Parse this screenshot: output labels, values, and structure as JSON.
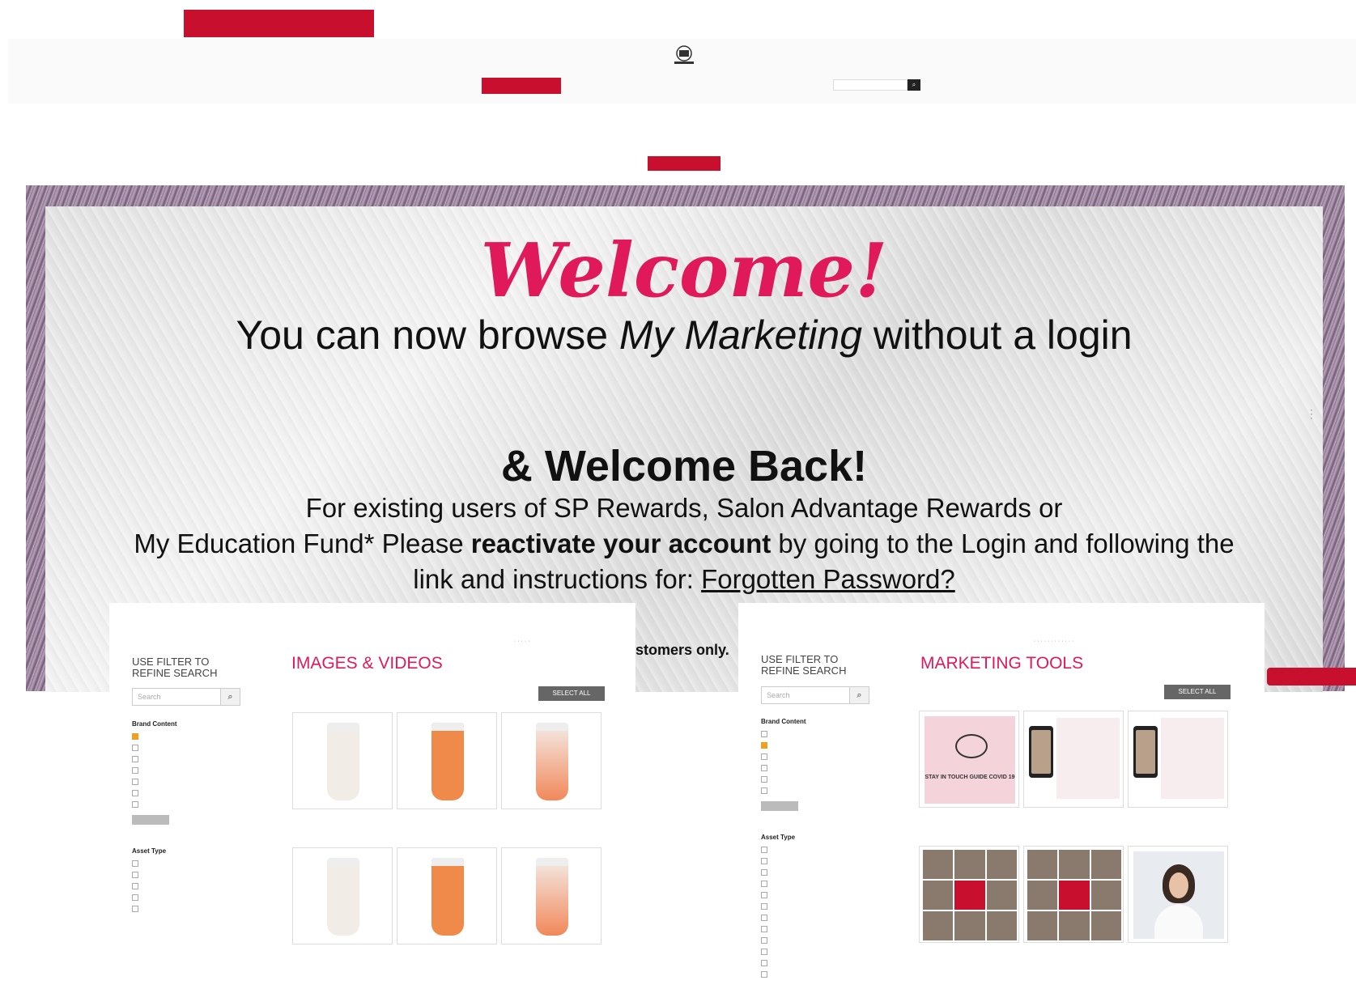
{
  "topbar": {
    "links": [
      "",
      "",
      "",
      ""
    ],
    "red_tabs": [
      "",
      "",
      ""
    ],
    "lang": ""
  },
  "nav": {
    "primary": "",
    "items": [
      "",
      "",
      "",
      "",
      ""
    ],
    "search_placeholder": ""
  },
  "announce": {
    "title": "",
    "body": "",
    "button": ""
  },
  "hero": {
    "welcome": "Welcome!",
    "browse_pre": "You can now browse ",
    "browse_em": "My Marketing",
    "browse_post": " without a login",
    "welcome_back": "& Welcome Back!",
    "existing_line1": "For existing users of SP Rewards, Salon Advantage Rewards or",
    "existing_line2_pre": "My Education Fund* Please ",
    "existing_line2_bold": "reactivate your account",
    "existing_line2_post": " by going to the Login and following the",
    "existing_line3_pre": "link and instructions for: ",
    "forgot_link": "Forgotten Password?",
    "customers": "stomers only."
  },
  "panel_left": {
    "filter_title": "USE FILTER TO REFINE SEARCH",
    "search_placeholder": "Search",
    "heading": "IMAGES & VIDEOS",
    "select_all": "SELECT ALL",
    "brand_content_label": "Brand Content",
    "asset_type_label": "Asset Type"
  },
  "panel_right": {
    "filter_title": "USE FILTER TO REFINE SEARCH",
    "search_placeholder": "Search",
    "heading": "MARKETING TOOLS",
    "select_all": "SELECT ALL",
    "brand_content_label": "Brand Content",
    "asset_type_label": "Asset Type",
    "pink_card_text": "STAY IN TOUCH GUIDE COVID 19"
  },
  "colors": {
    "brand_red": "#c8102e",
    "welcome_pink": "#e0195a"
  }
}
